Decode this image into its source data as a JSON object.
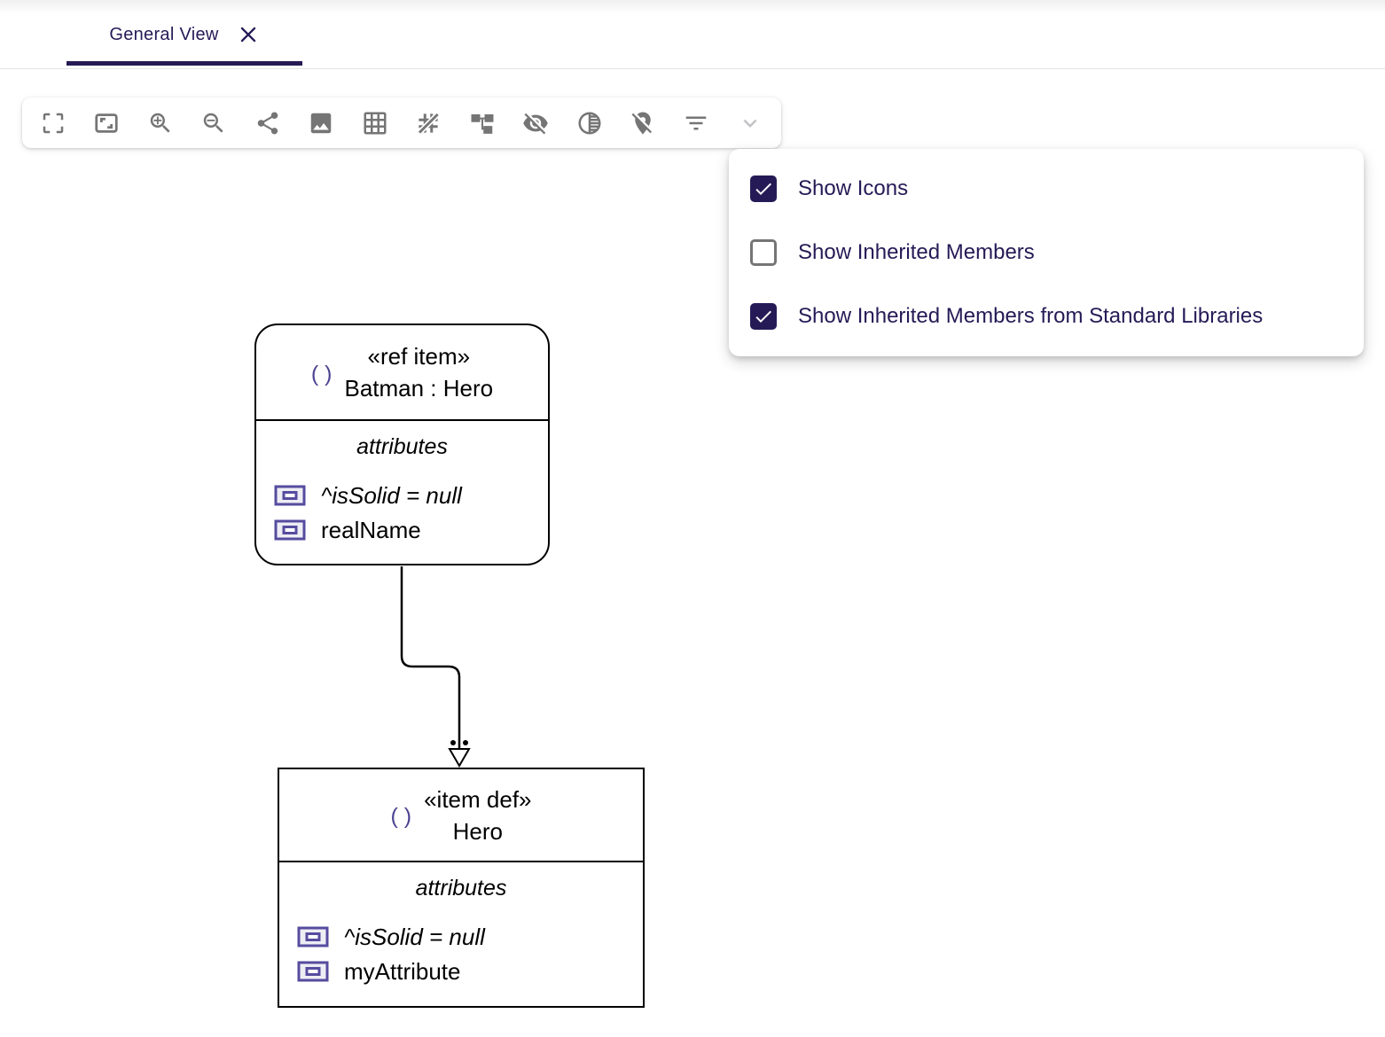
{
  "tab_bar": {
    "active_tab": {
      "label": "General View"
    }
  },
  "toolbar": {
    "icons": [
      "fullscreen",
      "fit-to-screen",
      "zoom-in",
      "zoom-out",
      "share",
      "export-image",
      "grid-on",
      "grid-off",
      "arrange-all",
      "reveal-hidden-elements",
      "reveal-faded-elements",
      "unpin-elements",
      "filter",
      "expand-more"
    ]
  },
  "filter_menu": {
    "items": [
      {
        "label": "Show Icons",
        "checked": true
      },
      {
        "label": "Show Inherited Members",
        "checked": false
      },
      {
        "label": "Show Inherited Members from Standard Libraries",
        "checked": true
      }
    ]
  },
  "diagram": {
    "nodes": [
      {
        "stereotype": "«ref item»",
        "name": "Batman : Hero",
        "icon": "( )",
        "compartment_label": "attributes",
        "attributes": [
          {
            "text": "^isSolid = null",
            "inherited": true
          },
          {
            "text": "realName",
            "inherited": false
          }
        ]
      },
      {
        "stereotype": "«item def»",
        "name": "Hero",
        "icon": "( )",
        "compartment_label": "attributes",
        "attributes": [
          {
            "text": "^isSolid = null",
            "inherited": true
          },
          {
            "text": "myAttribute",
            "inherited": false
          }
        ]
      }
    ],
    "edge": {
      "source": "Batman : Hero",
      "target": "Hero",
      "style": "solid",
      "arrowhead": "hollow-triangle",
      "dot_count": 2
    }
  },
  "colors": {
    "accent": "#261A56",
    "toolbar_icon": "#757575",
    "disabled_icon": "#c3c3c7",
    "attr_icon_purple": "#554C9F",
    "node_border": "#000000",
    "divider": "#e4e4e7"
  }
}
